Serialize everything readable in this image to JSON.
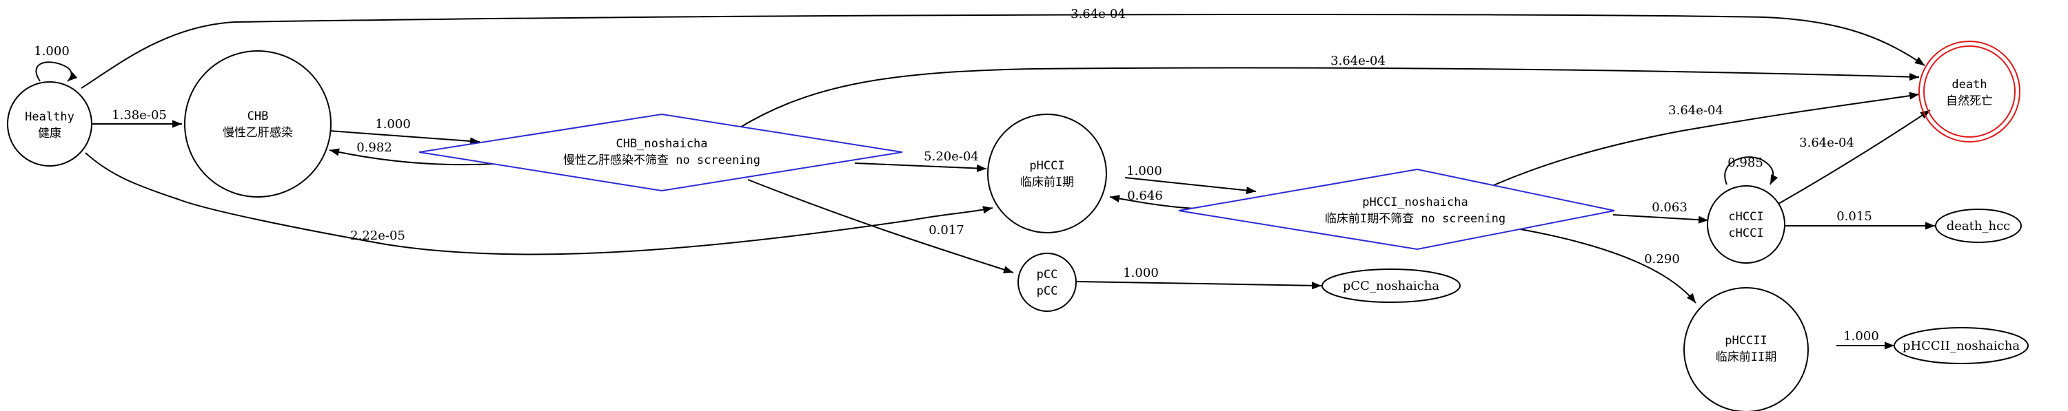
{
  "nodes": {
    "healthy": {
      "line1": "Healthy",
      "line2": "健康"
    },
    "chb": {
      "line1": "CHB",
      "line2": "慢性乙肝感染"
    },
    "chb_noshaicha": {
      "line1": "CHB_noshaicha",
      "line2": "慢性乙肝感染不筛查 no screening"
    },
    "phcci": {
      "line1": "pHCCI",
      "line2": "临床前I期"
    },
    "phcci_noshaicha": {
      "line1": "pHCCI_noshaicha",
      "line2": "临床前I期不筛查 no screening"
    },
    "pcc": {
      "line1": "pCC",
      "line2": "pCC"
    },
    "pcc_noshaicha": {
      "line1": "pCC_noshaicha"
    },
    "chcci": {
      "line1": "cHCCI",
      "line2": "cHCCI"
    },
    "death_hcc": {
      "line1": "death_hcc"
    },
    "phccii": {
      "line1": "pHCCII",
      "line2": "临床前II期"
    },
    "phccii_noshaicha": {
      "line1": "pHCCII_noshaicha"
    },
    "death": {
      "line1": "death",
      "line2": "自然死亡"
    }
  },
  "edges": {
    "healthy_self": "1.000",
    "healthy_chb": "1.38e-05",
    "healthy_death": "3.64e-04",
    "healthy_phcci": "2.22e-05",
    "chb_chbns": "1.000",
    "chbns_chb": "0.982",
    "chbns_death": "3.64e-04",
    "chbns_phcci": "5.20e-04",
    "chbns_pcc": "0.017",
    "phcci_phccins": "1.000",
    "phccins_phcci": "0.646",
    "phccins_death": "3.64e-04",
    "phccins_chcci": "0.063",
    "phccins_phccii": "0.290",
    "pcc_pccns": "1.000",
    "chcci_self": "0.985",
    "chcci_death": "3.64e-04",
    "chcci_deathhcc": "0.015",
    "phccii_phcciins": "1.000"
  }
}
